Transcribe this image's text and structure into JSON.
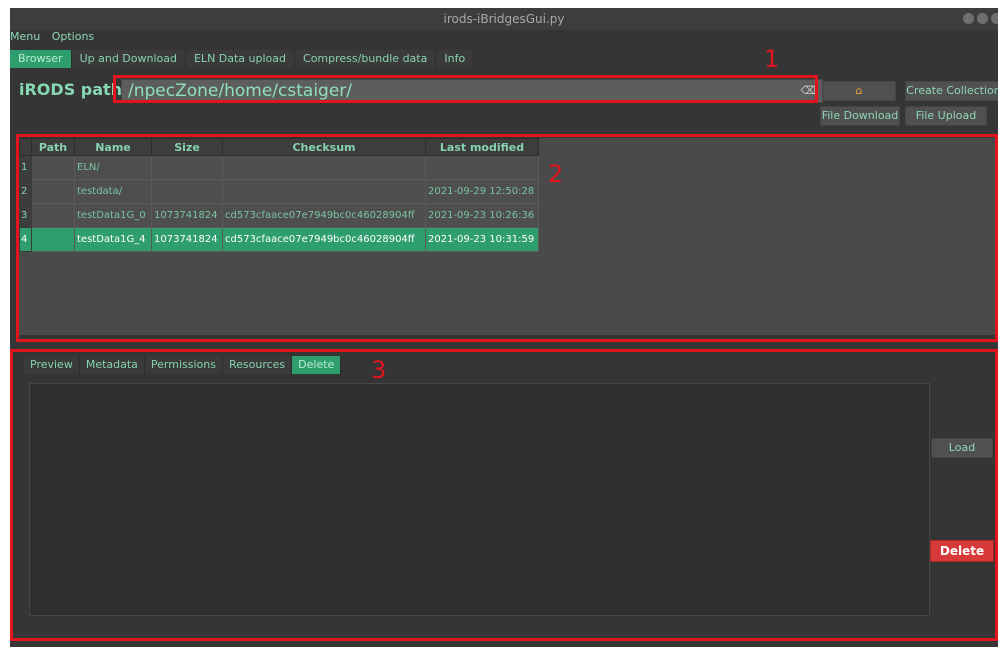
{
  "window": {
    "title": "irods-iBridgesGui.py"
  },
  "menubar": {
    "items": [
      "Menu",
      "Options"
    ]
  },
  "main_tabs": [
    "Browser",
    "Up and Download",
    "ELN Data upload",
    "Compress/bundle data",
    "Info"
  ],
  "path": {
    "label": "iRODS path:",
    "value": "/npecZone/home/cstaiger/"
  },
  "buttons": {
    "home_icon": "home-icon",
    "create_collection": "Create Collection",
    "file_download": "File Download",
    "file_upload": "File Upload",
    "load": "Load",
    "delete": "Delete"
  },
  "table": {
    "headers": [
      "Path",
      "Name",
      "Size",
      "Checksum",
      "Last modified"
    ],
    "rows": [
      {
        "num": "1",
        "path": "",
        "name": "ELN/",
        "size": "",
        "checksum": "",
        "modified": ""
      },
      {
        "num": "2",
        "path": "",
        "name": "testdata/",
        "size": "",
        "checksum": "",
        "modified": "2021-09-29 12:50:28"
      },
      {
        "num": "3",
        "path": "",
        "name": "testData1G_0",
        "size": "1073741824",
        "checksum": "cd573cfaace07e7949bc0c46028904ff",
        "modified": "2021-09-23 10:26:36"
      },
      {
        "num": "4",
        "path": "",
        "name": "testData1G_4",
        "size": "1073741824",
        "checksum": "cd573cfaace07e7949bc0c46028904ff",
        "modified": "2021-09-23 10:31:59"
      }
    ],
    "selected_row": 4
  },
  "detail_tabs": [
    "Preview",
    "Metadata",
    "Permissions",
    "Resources",
    "Delete"
  ],
  "annotations": [
    "1",
    "2",
    "3"
  ],
  "colors": {
    "accent": "#2f9e6f",
    "annotation": "#e2141d",
    "delete": "#d83a3a",
    "text": "#7bd1a8"
  }
}
